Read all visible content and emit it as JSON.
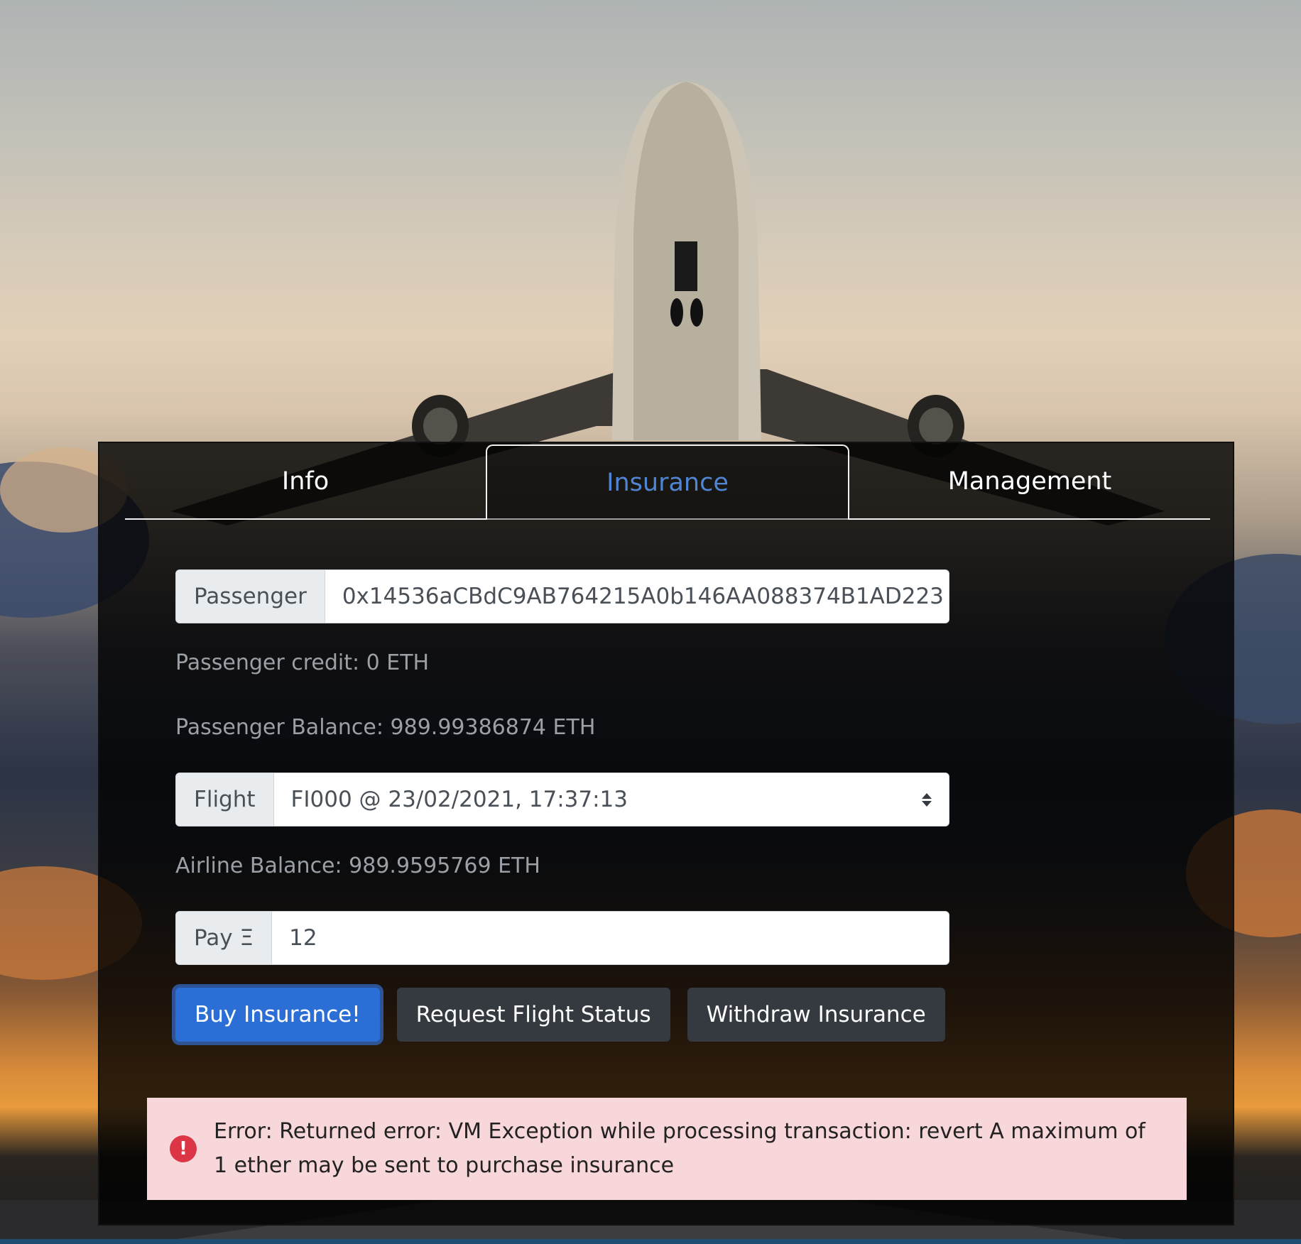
{
  "tabs": [
    {
      "label": "Info",
      "active": false
    },
    {
      "label": "Insurance",
      "active": true
    },
    {
      "label": "Management",
      "active": false
    }
  ],
  "passenger": {
    "label": "Passenger",
    "selected": "0x14536aCBdC9AB764215A0b146AA088374B1AD223"
  },
  "passenger_credit": "Passenger credit: 0 ETH",
  "passenger_balance": "Passenger Balance: 989.99386874 ETH",
  "flight": {
    "label": "Flight",
    "selected": "FI000 @ 23/02/2021, 17:37:13"
  },
  "airline_balance": "Airline Balance: 989.9595769 ETH",
  "pay": {
    "label": "Pay Ξ",
    "value": "12"
  },
  "buttons": {
    "buy": "Buy Insurance!",
    "status": "Request Flight Status",
    "withdraw": "Withdraw Insurance"
  },
  "alert": {
    "icon": "!",
    "message": "Error: Returned error: VM Exception while processing transaction: revert A maximum of 1 ether may be sent to purchase insurance"
  },
  "colors": {
    "active_tab": "#4f86d4",
    "primary_button": "#2b6fd6",
    "dark_button": "#343a40",
    "alert_bg": "#f8d7da",
    "alert_icon": "#dc3545"
  },
  "background": {
    "icon": "airplane-photo"
  }
}
